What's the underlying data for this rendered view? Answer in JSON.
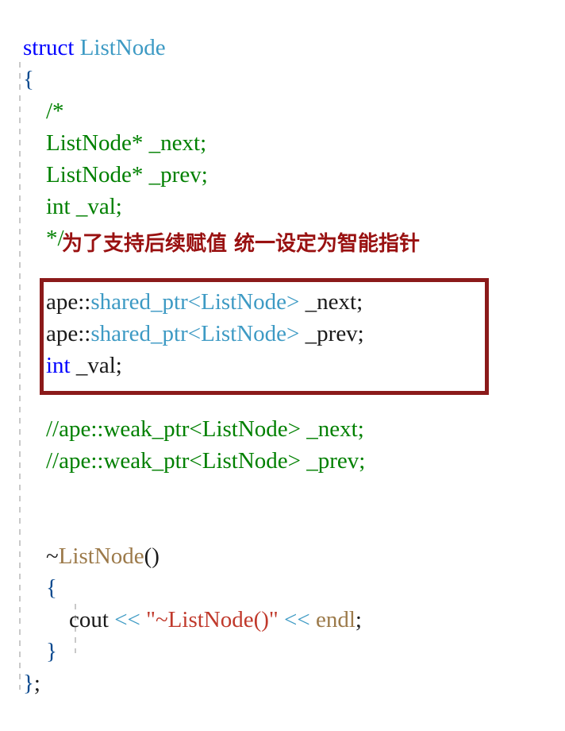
{
  "editor": {
    "language": "cpp",
    "background_color": "#ffffff",
    "colors": {
      "keyword": "#0000ff",
      "user_type": "#3d9ac4",
      "comment": "#008000",
      "string": "#c0392b",
      "function": "#9c7a4a",
      "operator": "#3d9ac4",
      "brace": "#0b4a8f",
      "plain_text": "#1a1a1a",
      "annotation_red": "#991111",
      "highlight_border": "#8b1a1a",
      "indent_guide": "#c9c9c9"
    }
  },
  "annotation": {
    "note_text": "为了支持后续赋值 统一设定为智能指针"
  },
  "lines": {
    "l1": {
      "kw": "struct",
      "sp": " ",
      "type": "ListNode"
    },
    "l2": {
      "brace": "{"
    },
    "l3": {
      "indent": "    ",
      "comment": "/*"
    },
    "l4": {
      "indent": "    ",
      "comment": "ListNode* _next;"
    },
    "l5": {
      "indent": "    ",
      "comment": "ListNode* _prev;"
    },
    "l6": {
      "indent": "    ",
      "comment": "int _val;"
    },
    "l7": {
      "indent": "    ",
      "comment": "*/"
    },
    "l9": {
      "indent": "    ",
      "ns": "ape::",
      "type": "shared_ptr<ListNode>",
      "member": " _next;"
    },
    "l10": {
      "indent": "    ",
      "ns": "ape::",
      "type": "shared_ptr<ListNode>",
      "member": " _prev;"
    },
    "l11": {
      "indent": "    ",
      "kw": "int",
      "member": " _val;"
    },
    "l13": {
      "indent": "    ",
      "comment": "//ape::weak_ptr<ListNode> _next;"
    },
    "l14": {
      "indent": "    ",
      "comment": "//ape::weak_ptr<ListNode> _prev;"
    },
    "l17": {
      "indent": "    ",
      "tilde": "~",
      "func": "ListNode",
      "parens": "()"
    },
    "l18": {
      "indent": "    ",
      "brace": "{"
    },
    "l19": {
      "indent": "        ",
      "stream": "cout",
      "op1": " << ",
      "string": "\"~ListNode()\"",
      "op2": " << ",
      "endl": "endl",
      "semi": ";"
    },
    "l20": {
      "indent": "    ",
      "brace": "}"
    },
    "l21": {
      "brace": "}",
      "semi": ";"
    }
  }
}
